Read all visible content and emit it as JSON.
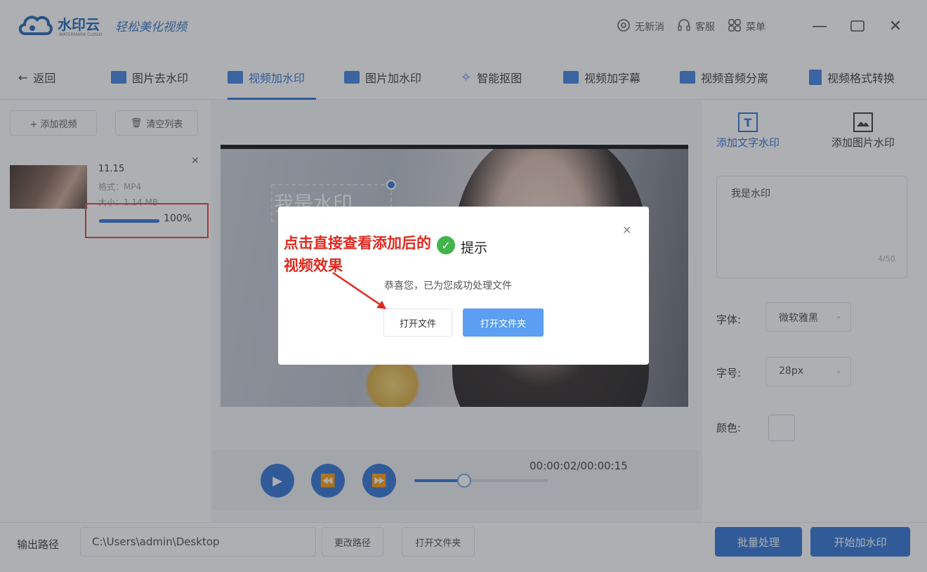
{
  "app": {
    "name": "水印云",
    "name_sub": "WATERMARK CLOUD",
    "slogan": "轻松美化视频",
    "top_actions": [
      {
        "label": "无新消",
        "icon": "settings-gear-icon"
      },
      {
        "label": "客服",
        "icon": "headset-icon"
      },
      {
        "label": "菜单",
        "icon": "menu-grid-icon"
      }
    ]
  },
  "nav": {
    "back_label": "返回",
    "items": [
      {
        "label": "图片去水印"
      },
      {
        "label": "视频加水印",
        "active": true
      },
      {
        "label": "图片加水印"
      },
      {
        "label": "智能抠图"
      },
      {
        "label": "视频加字幕"
      },
      {
        "label": "视频音频分离"
      },
      {
        "label": "视频格式转换"
      }
    ]
  },
  "left": {
    "add_video_label": "+ 添加视频",
    "clear_list_label": "清空列表",
    "file": {
      "name": "11.15",
      "format": "格式：MP4",
      "size": "大小：1.14 MB",
      "progress_text": "100%",
      "progress": 1.0
    }
  },
  "player": {
    "watermark_text": "我是水印",
    "time": "00:00:02/00:00:15",
    "position": 0.13
  },
  "right": {
    "tab_text": "添加文字水印",
    "tab_image": "添加图片水印",
    "watermark_input": "我是水印",
    "counter": "4/50",
    "font_label": "字体:",
    "font_value": "微软雅黑",
    "size_label": "字号:",
    "size_value": "28px",
    "color_label": "颜色:"
  },
  "bottom": {
    "output_label": "输出路径",
    "output_path": "C:\\Users\\admin\\Desktop",
    "change_path": "更改路径",
    "open_folder": "打开文件夹",
    "batch": "批量处理",
    "start": "开始加水印"
  },
  "dialog": {
    "title": "提示",
    "message": "恭喜您，已为您成功处理文件",
    "open_file": "打开文件",
    "open_folder": "打开文件夹"
  },
  "annotation": {
    "text": "点击直接查看添加后的视频效果",
    "color": "#e02a20"
  },
  "colors": {
    "accent": "#2a6fd3",
    "success": "#3fb54a"
  }
}
